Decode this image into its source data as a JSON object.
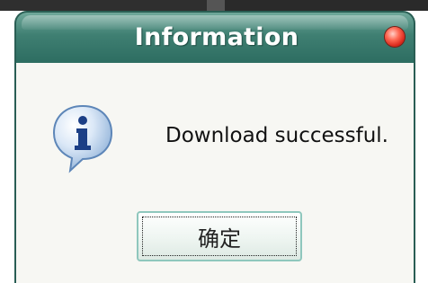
{
  "dialog": {
    "title": "Information",
    "message": "Download successful.",
    "ok_label": "确定",
    "icon": "info-icon",
    "close_icon": "close-icon"
  },
  "colors": {
    "titlebar": "#3f7f72",
    "title_text": "#ffffff",
    "close_button": "#d8261a",
    "body_bg": "#f7f7f3",
    "button_border": "#8fc7bd",
    "background_strip": "#3a3a3a"
  }
}
